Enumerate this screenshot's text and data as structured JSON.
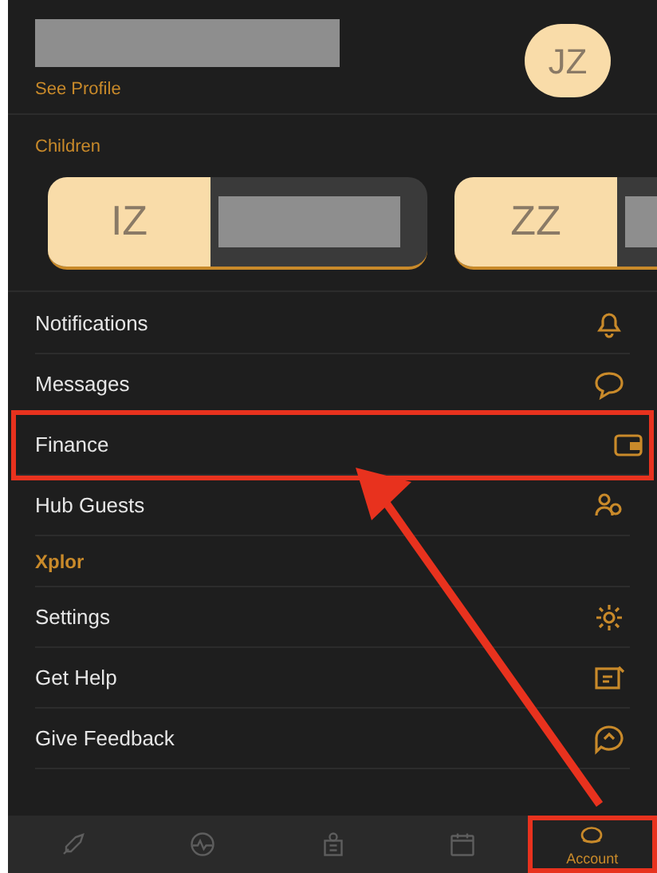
{
  "profile": {
    "link": "See Profile",
    "avatar": "JZ"
  },
  "children": {
    "title": "Children",
    "cards": [
      {
        "initials": "IZ"
      },
      {
        "initials": "ZZ"
      }
    ]
  },
  "menu": [
    {
      "kind": "item",
      "label": "Notifications",
      "annotated": false
    },
    {
      "kind": "item",
      "label": "Messages",
      "annotated": false
    },
    {
      "kind": "item",
      "label": "Finance",
      "annotated": true
    },
    {
      "kind": "item",
      "label": "Hub Guests",
      "annotated": false
    },
    {
      "kind": "section",
      "label": "Xplor"
    },
    {
      "kind": "item",
      "label": "Settings",
      "annotated": false
    },
    {
      "kind": "item",
      "label": "Get Help",
      "annotated": false
    },
    {
      "kind": "item",
      "label": "Give Feedback",
      "annotated": false
    }
  ],
  "tabs": [
    {
      "selected": false,
      "annotated": false
    },
    {
      "selected": false,
      "annotated": false
    },
    {
      "selected": false,
      "annotated": false
    },
    {
      "selected": false,
      "annotated": false
    },
    {
      "label": "Account",
      "selected": true,
      "annotated": true
    }
  ]
}
